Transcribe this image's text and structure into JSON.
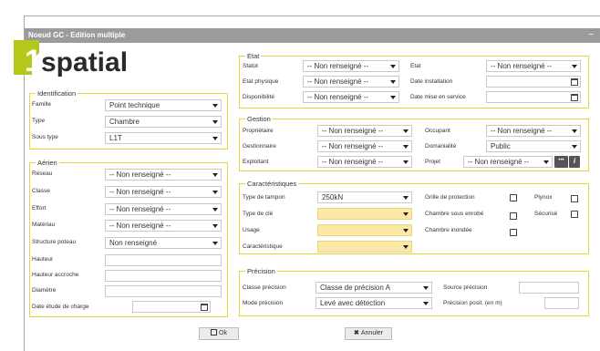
{
  "window": {
    "title": "Noeud GC - Edition multiple",
    "close_glyph": "–"
  },
  "logo": {
    "digit": "1",
    "text": "spatial"
  },
  "identification": {
    "legend": "Identification",
    "famille_label": "Famille",
    "famille_value": "Point technique",
    "type_label": "Type",
    "type_value": "Chambre",
    "sous_type_label": "Sous type",
    "sous_type_value": "L1T"
  },
  "aerien": {
    "legend": "Aérien",
    "reseau_label": "Réseau",
    "reseau_value": "-- Non renseigné --",
    "classe_label": "Classe",
    "classe_value": "-- Non renseigné --",
    "effort_label": "Effort",
    "effort_value": "-- Non renseigné --",
    "materiau_label": "Matériau",
    "materiau_value": "-- Non renseigné --",
    "structure_label": "Structure poteau",
    "structure_value": "Non renseigné",
    "hauteur_label": "Hauteur",
    "hauteur_accroche_label": "Hauteur accroche",
    "diametre_label": "Diamètre",
    "date_etude_label": "Date étude de charge"
  },
  "etat": {
    "legend": "Etat",
    "statut_label": "Statut",
    "statut_value": "-- Non renseigné --",
    "etat_physique_label": "Etat physique",
    "etat_physique_value": "-- Non renseigné --",
    "disponibilite_label": "Disponibilité",
    "disponibilite_value": "-- Non renseigné --",
    "etat_label": "Etat",
    "etat_value": "-- Non renseigné --",
    "date_installation_label": "Date installation",
    "date_service_label": "Date mise en service"
  },
  "gestion": {
    "legend": "Gestion",
    "proprietaire_label": "Propriétaire",
    "proprietaire_value": "-- Non renseigné --",
    "gestionnaire_label": "Gestionnaire",
    "gestionnaire_value": "-- Non renseigné --",
    "exploitant_label": "Exploitant",
    "exploitant_value": "-- Non renseigné --",
    "occupant_label": "Occupant",
    "occupant_value": "-- Non renseigné --",
    "domanialite_label": "Domanialité",
    "domanialite_value": "Public",
    "projet_label": "Projet",
    "projet_value": "-- Non renseigné --",
    "more_glyph": "•••",
    "info_glyph": "i"
  },
  "caracteristiques": {
    "legend": "Caractéristiques",
    "type_tampon_label": "Type de tampon",
    "type_tampon_value": "250kN",
    "type_cle_label": "Type de clé",
    "usage_label": "Usage",
    "caracteristique_label": "Caractéristique",
    "grille_label": "Grille de protection",
    "chambre_enrobe_label": "Chambre sous enrobé",
    "chambre_inondee_label": "Chambre inondée",
    "plynox_label": "Plynox",
    "securise_label": "Sécurisé"
  },
  "precision": {
    "legend": "Précision",
    "classe_label": "Classe précision",
    "classe_value": "Classe de précision A",
    "mode_label": "Mode précision",
    "mode_value": "Levé avec détection",
    "source_label": "Source précision",
    "position_label": "Précision posit. (en m)"
  },
  "buttons": {
    "ok_label": "Ok",
    "cancel_label": "Annuler"
  },
  "colors": {
    "accent_yellow": "#e4d63a",
    "logo_green": "#b6c71b",
    "titlebar": "#9b9b9b",
    "required_field": "#fce9a6"
  }
}
